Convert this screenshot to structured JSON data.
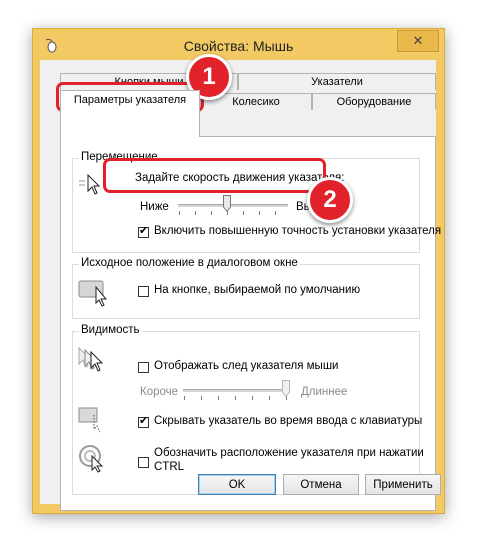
{
  "window": {
    "title": "Свойства: Мышь",
    "close_glyph": "✕"
  },
  "tabs": {
    "back_row": [
      "Кнопки мыши",
      "Указатели"
    ],
    "front_row": [
      "Параметры указателя",
      "Колесико",
      "Оборудование"
    ],
    "active": "Параметры указателя"
  },
  "motion": {
    "label": "Перемещение",
    "speed_prompt": "Задайте скорость движения указателя:",
    "slow_label": "Ниже",
    "fast_label": "Выше",
    "speed_value": 0.5,
    "precision_label": "Включить повышенную точность установки указателя",
    "precision_checked": true
  },
  "snap": {
    "label": "Исходное положение в диалоговом окне",
    "option_label": "На кнопке, выбираемой по умолчанию",
    "checked": false
  },
  "visibility": {
    "label": "Видимость",
    "trails_label": "Отображать след указателя мыши",
    "trails_checked": false,
    "short_label": "Короче",
    "long_label": "Длиннее",
    "trails_value": 1.0,
    "hide_label": "Скрывать указатель во время ввода с клавиатуры",
    "hide_checked": true,
    "ctrl_label_line1": "Обозначить расположение указателя при нажатии",
    "ctrl_label_line2": "CTRL",
    "ctrl_checked": false
  },
  "buttons": {
    "ok": "OK",
    "cancel": "Отмена",
    "apply": "Применить"
  },
  "annotations": {
    "badge1": "1",
    "badge2": "2",
    "color": "#e1222b"
  },
  "colors": {
    "frame": "#f2c962",
    "dialog": "#f0f0f0",
    "panel": "#ffffff"
  },
  "icons": [
    "mouse-app-icon",
    "pointer-speed-icon",
    "snap-to-icon",
    "pointer-trails-icon",
    "hide-pointer-icon",
    "locate-pointer-icon"
  ]
}
